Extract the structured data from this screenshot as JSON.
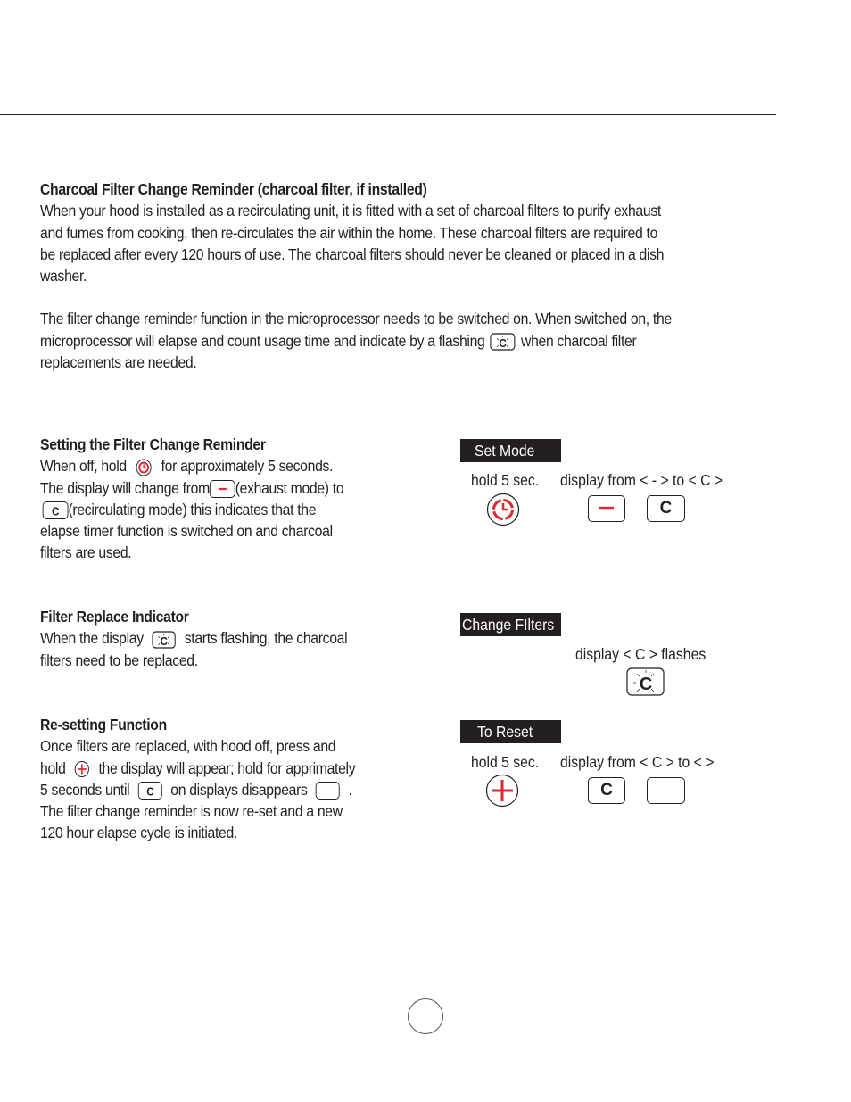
{
  "intro": {
    "title": "Charcoal Filter Change Reminder (charcoal filter, if installed)",
    "lines": [
      "When your hood is installed as a recirculating unit, it is fitted with a set of charcoal filters to purify exhaust",
      "and fumes from cooking, then re-circulates the air within the home.  These charcoal filters are required to",
      "be replaced after every 120 hours of use.  The charcoal filters should never be cleaned or placed in a dish",
      "washer."
    ],
    "p2_line1": "The filter change reminder function in the microprocessor needs to be switched on.  When switched on, the",
    "p2_line2_before": "microprocessor will elapse and count usage time and indicate by a flashing",
    "p2_line2_after": "when charcoal filter",
    "p2_line3": "replacements are needed."
  },
  "setting": {
    "title": "Setting the Filter Change Reminder",
    "l1_before": "When off, hold",
    "l1_after": "for approximately 5 seconds.",
    "l2_before": "The display will change from",
    "l2_after": "(exhaust mode)  to",
    "l3_after": "(recirculating mode)  this indicates that the",
    "l4": "elapse timer function is switched on and charcoal",
    "l5": "filters are used.",
    "tag": "Set Mode",
    "hold_caption": "hold 5 sec.",
    "display_caption": "display from  < - > to < C >",
    "display_from": "–",
    "display_to": "C"
  },
  "replace": {
    "title": "Filter Replace Indicator",
    "l1_before": "When the display",
    "l1_after": "starts flashing, the charcoal",
    "l2": "filters need to be replaced.",
    "tag": "Change FIlters",
    "display_caption": "display < C > flashes",
    "display_value": "C"
  },
  "reset": {
    "title": "Re-setting Function",
    "l1": "Once filters are replaced, with hood off, press and",
    "l2_before": "hold",
    "l2_after": "the display will appear;  hold for apprimately",
    "l3_before": "5 seconds until",
    "l3_mid": "on displays disappears",
    "l3_after": ".",
    "l4": "The filter change reminder is now re-set and a new",
    "l5": "120 hour elapse cycle is initiated.",
    "tag": "To Reset",
    "hold_caption": "hold 5 sec.",
    "display_caption": "display from  < C > to <    >",
    "display_from": "C",
    "display_to": ""
  },
  "colors": {
    "accent_red": "#e4262c",
    "ink": "#231f20"
  }
}
